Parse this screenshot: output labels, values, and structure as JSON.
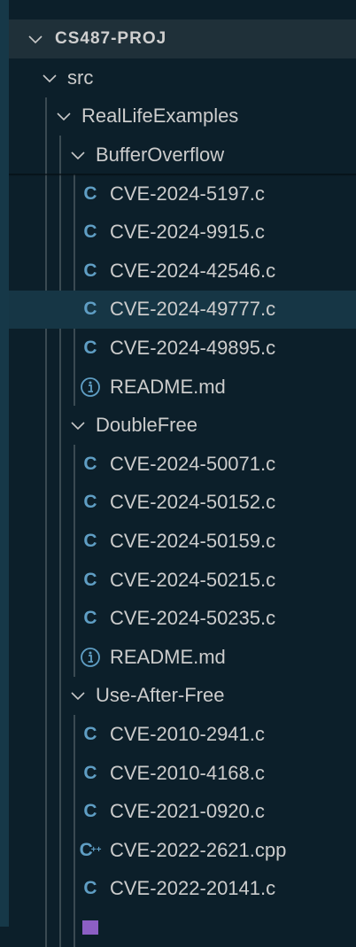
{
  "explorer": {
    "root": "CS487-PROJ",
    "rows": [
      {
        "label": "src",
        "type": "folder",
        "depth": 0
      },
      {
        "label": "RealLifeExamples",
        "type": "folder",
        "depth": 1
      },
      {
        "label": "BufferOverflow",
        "type": "folder",
        "depth": 2
      },
      {
        "label": "CVE-2024-5197.c",
        "type": "c",
        "depth": 3
      },
      {
        "label": "CVE-2024-9915.c",
        "type": "c",
        "depth": 3
      },
      {
        "label": "CVE-2024-42546.c",
        "type": "c",
        "depth": 3
      },
      {
        "label": "CVE-2024-49777.c",
        "type": "c",
        "depth": 3,
        "selected": true
      },
      {
        "label": "CVE-2024-49895.c",
        "type": "c",
        "depth": 3
      },
      {
        "label": "README.md",
        "type": "info",
        "depth": 3
      },
      {
        "label": "DoubleFree",
        "type": "folder",
        "depth": 2
      },
      {
        "label": "CVE-2024-50071.c",
        "type": "c",
        "depth": 3
      },
      {
        "label": "CVE-2024-50152.c",
        "type": "c",
        "depth": 3
      },
      {
        "label": "CVE-2024-50159.c",
        "type": "c",
        "depth": 3
      },
      {
        "label": "CVE-2024-50215.c",
        "type": "c",
        "depth": 3
      },
      {
        "label": "CVE-2024-50235.c",
        "type": "c",
        "depth": 3
      },
      {
        "label": "README.md",
        "type": "info",
        "depth": 3
      },
      {
        "label": "Use-After-Free",
        "type": "folder",
        "depth": 2
      },
      {
        "label": "CVE-2010-2941.c",
        "type": "c",
        "depth": 3
      },
      {
        "label": "CVE-2010-4168.c",
        "type": "c",
        "depth": 3
      },
      {
        "label": "CVE-2021-0920.c",
        "type": "c",
        "depth": 3
      },
      {
        "label": "CVE-2022-2621.cpp",
        "type": "cpp",
        "depth": 3
      },
      {
        "label": "CVE-2022-20141.c",
        "type": "c",
        "depth": 3
      },
      {
        "label": "",
        "type": "purple",
        "depth": 3
      }
    ]
  },
  "colors": {
    "c_icon": "#5f9ec4",
    "purple_icon": "#8c5fc4"
  }
}
